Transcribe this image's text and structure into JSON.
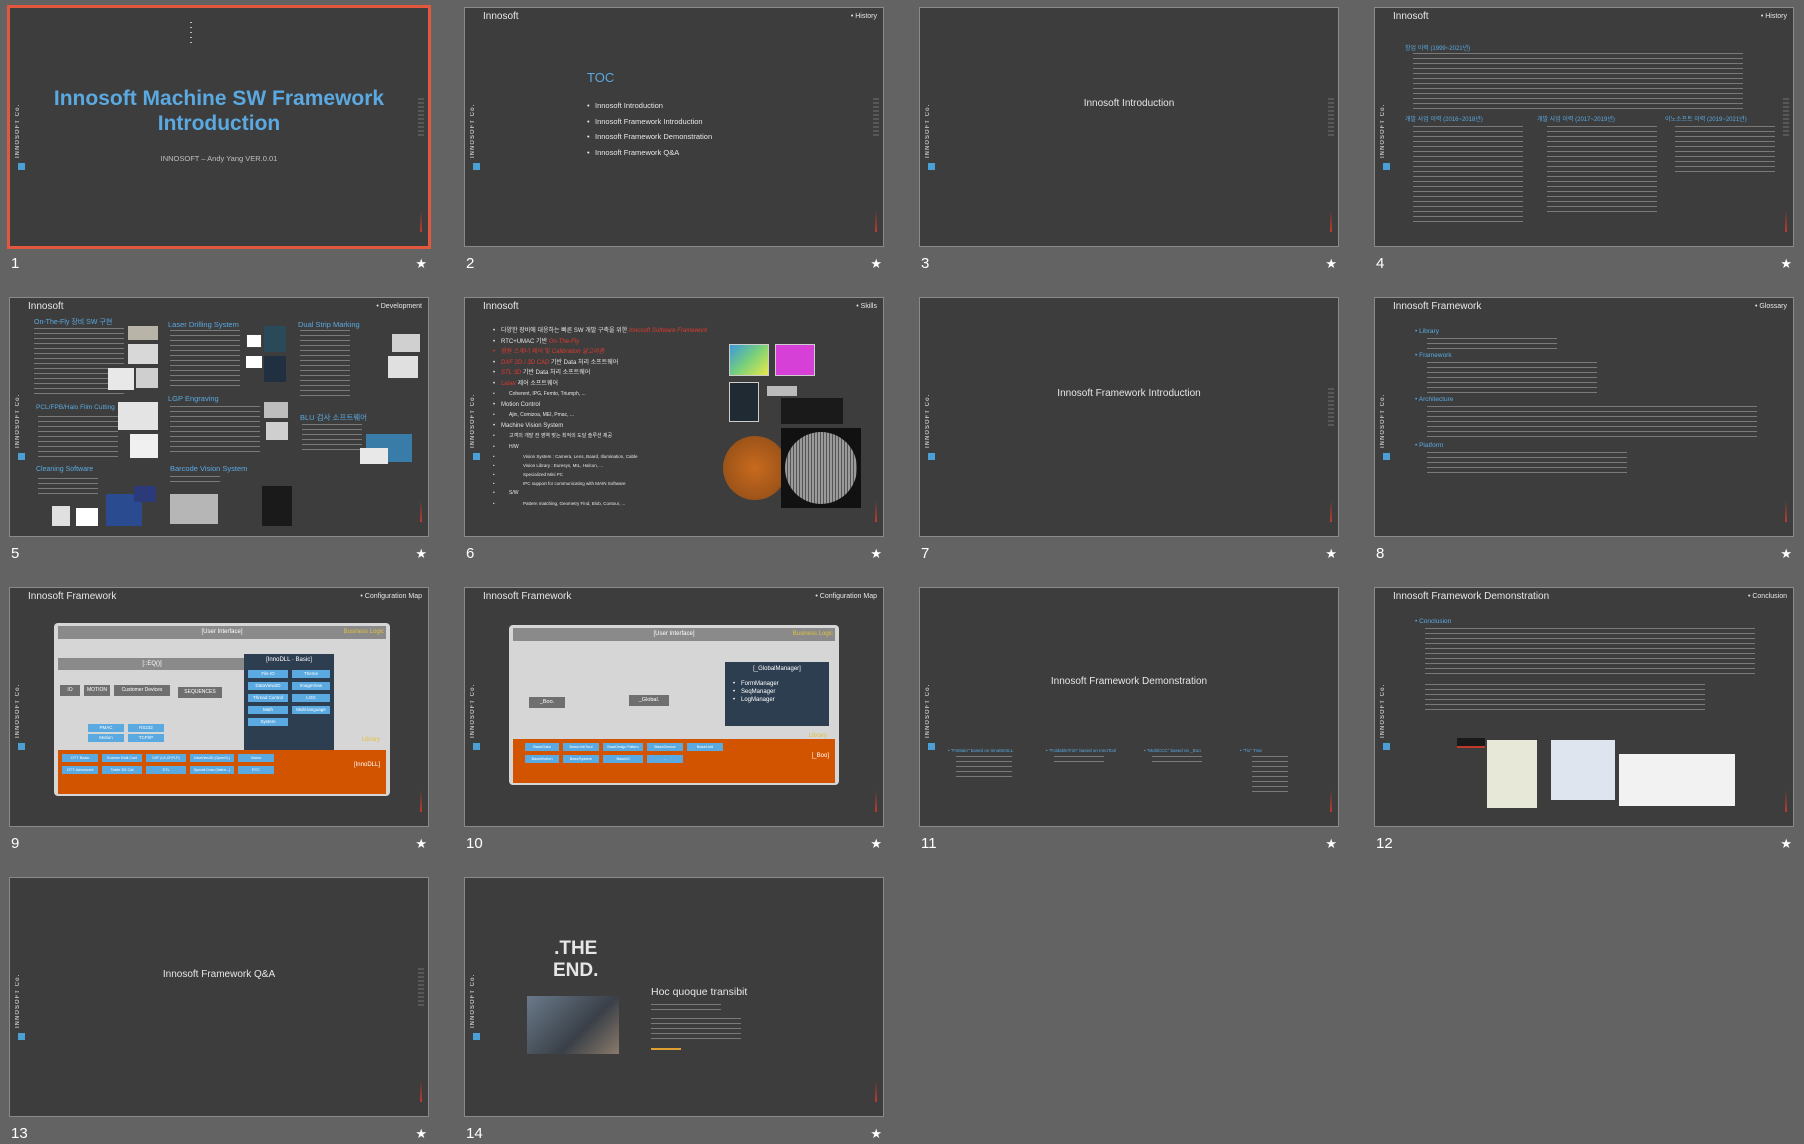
{
  "slides": [
    {
      "num": "1",
      "title": "Innosoft Machine SW Framework Introduction",
      "subtitle": "INNOSOFT – Andy Yang VER.0.01"
    },
    {
      "num": "2",
      "header": "Innosoft",
      "section": "History",
      "toc_title": "TOC",
      "toc": [
        "Innosoft Introduction",
        "Innosoft Framework Introduction",
        "Innosoft Framework Demonstration",
        "Innosoft Framework Q&A"
      ]
    },
    {
      "num": "3",
      "title": "Innosoft Introduction"
    },
    {
      "num": "4",
      "header": "Innosoft",
      "section": "History",
      "h1": "창업 이력 (1999~2021년)",
      "cols": [
        "개발 사업 이력 (2016~2018년)",
        "개발 사업 이력 (2017~2019년)",
        "이노소프트 이력 (2019~2021년)"
      ]
    },
    {
      "num": "5",
      "header": "Innosoft",
      "section": "Development",
      "labels": [
        "On-The-Fly 장비 SW 구현",
        "Laser Drilling System",
        "Dual Strip Marking",
        "PCL/FPB/Halo Film Cutting",
        "LGP Engraving",
        "BLU 검사 소프트웨어",
        "Cleaning Software",
        "Barcode Vision System"
      ]
    },
    {
      "num": "6",
      "header": "Innosoft",
      "section": "Skills",
      "lines": [
        {
          "a": "다양한 장비에 대응하는 빠른 SW 개발 구축을 위한 ",
          "b": "Innosoft Software Framework"
        },
        {
          "a": "RTC+UMAC 기반 ",
          "b": "On-The-Fly"
        },
        {
          "a": "광원 스캐너 제어 및 ",
          "b": "Calibration 알고리즘"
        },
        {
          "a": "",
          "b": "DXF 2D / 3D CAD",
          "c": " 기반 Data 처리 소프트웨어"
        },
        {
          "a": "",
          "b": "STL 3D",
          "c": " 기반 Data 처리 소프트웨어"
        },
        {
          "a": "",
          "b": "Laser",
          "c": " 제어 소프트웨어"
        }
      ],
      "sub1": "Coherent, IPG, Femto, Triumph, ...",
      "m1": "Motion Control",
      "sub2": "Ajin, Comizoa, MEI, Pmac, ...",
      "m2": "Machine Vision System",
      "sub3": "고객의 개발 전 영역 맞는 최적의 도달 솔루션 제공",
      "hw": "H/W",
      "hw_items": [
        "Vision System : Camera, Lens, Board, Illumination, Cable",
        "Vision Library : Euresys, MIL, Halcon, ...",
        "Specialized Mini PC",
        "IPC support for communicating with MAIN Software"
      ],
      "sw": "S/W",
      "sw_items": [
        "Pattern matching, Geometry Find, Blob, Contour, ..."
      ]
    },
    {
      "num": "7",
      "title": "Innosoft Framework Introduction"
    },
    {
      "num": "8",
      "header": "Innosoft Framework",
      "section": "Glossary",
      "terms": [
        "Library",
        "Framework",
        "Architecture",
        "Platform"
      ]
    },
    {
      "num": "9",
      "header": "Innosoft Framework",
      "section": "Configuration Map",
      "ui": "[User Interface]",
      "biz": "Business Logic",
      "eq": "[::EQ()]",
      "basic": "[InnoDLL · Basic]",
      "boxes": [
        "IO",
        "MOTION",
        "Customer Devices",
        "SEQUENCES"
      ],
      "basic_items": [
        "File IO",
        "Theme",
        "DataView2D",
        "ImageView",
        "Thread Control",
        "LOG",
        "Math",
        "Multi-language",
        "System"
      ],
      "mid": [
        "PMAC",
        "RS232",
        "Motion",
        "TCP/IP"
      ],
      "lib": "Library",
      "innodll": "[InnoDLL]",
      "bottom": [
        "OTT Basic",
        "Scanner Multi-Card",
        "DXF (LA,CP,FLP)",
        "DataView3D (OpenGL)",
        "Vision",
        "OTT Advanced",
        "Table 3D Cal",
        "STL",
        "Special Draw (Matrix...)",
        "RTC"
      ]
    },
    {
      "num": "10",
      "header": "Innosoft Framework",
      "section": "Configuration Map",
      "ui": "[User Interface]",
      "biz": "Business Logic",
      "boo": "_Boo.",
      "global": "_Global.",
      "gm": "[_GlobalManager]",
      "gm_items": [
        "FormManager",
        "SeqManager",
        "LogManager"
      ],
      "lib": "Library",
      "lib2": "[_Boo]",
      "bottom": [
        "BaseData",
        "BaseJobTool",
        "BaseDesign Pattern",
        "BaseDevice",
        "BaseUnit",
        "BaseMotion",
        "BaseSystem",
        "BaseUI",
        "..."
      ]
    },
    {
      "num": "11",
      "title": "Innosoft Framework Demonstration",
      "cols": [
        "\"FSMain\" based on InnoMcSLL",
        "\"FoldableTrim\" based on InnoTool",
        "\"MultiCCC\" based on _Boo",
        "\"Tix\" Trav"
      ]
    },
    {
      "num": "12",
      "header": "Innosoft Framework Demonstration",
      "section": "Conclusion",
      "h": "Conclusion"
    },
    {
      "num": "13",
      "title": "Innosoft Framework Q&A"
    },
    {
      "num": "14",
      "end": ".THE END.",
      "end1": ".THE",
      "end2": "END.",
      "tag": "Hoc quoque transibit"
    }
  ]
}
